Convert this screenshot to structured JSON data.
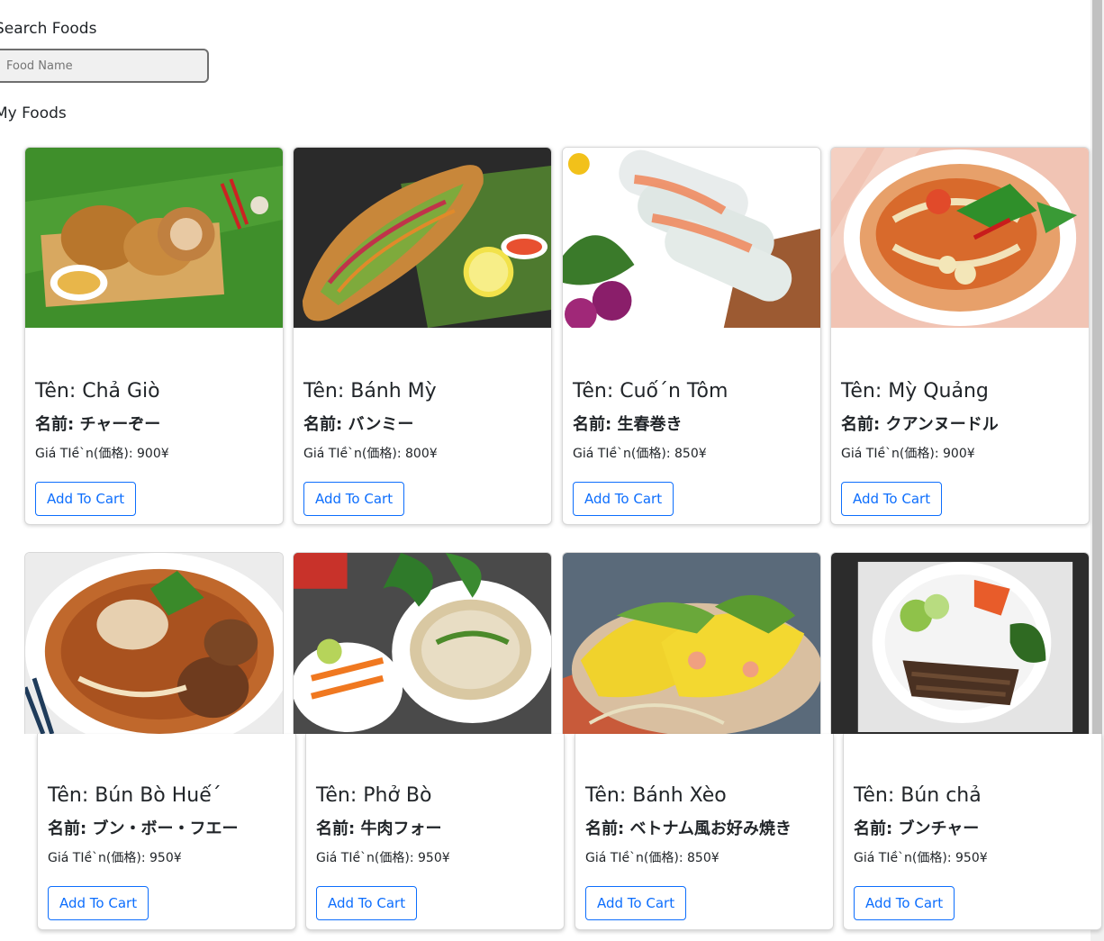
{
  "search": {
    "label": "Search Foods",
    "placeholder": "Food Name",
    "value": ""
  },
  "section": {
    "title": "My Foods"
  },
  "foods": [
    {
      "vn": "Tên: Chả Giò",
      "jp": "名前: チャーぞー",
      "price": "Giá TIề`n(価格): 900¥",
      "button": "Add To Cart"
    },
    {
      "vn": "Tên: Bánh Mỳ",
      "jp": "名前: バンミー",
      "price": "Giá TIề`n(価格): 800¥",
      "button": "Add To Cart"
    },
    {
      "vn": "Tên: Cuố´n Tôm",
      "jp": "名前: 生春巻き",
      "price": "Giá TIề`n(価格): 850¥",
      "button": "Add To Cart"
    },
    {
      "vn": "Tên: Mỳ Quảng",
      "jp": "名前: クアンヌードル",
      "price": "Giá TIề`n(価格): 900¥",
      "button": "Add To Cart"
    },
    {
      "vn": "Tên: Bún Bò Huế´",
      "jp": "名前: ブン・ボー・フエー",
      "price": "Giá TIề`n(価格): 950¥",
      "button": "Add To Cart"
    },
    {
      "vn": "Tên: Phở Bò",
      "jp": "名前: 牛肉フォー",
      "price": "Giá TIề`n(価格): 950¥",
      "button": "Add To Cart"
    },
    {
      "vn": "Tên: Bánh Xèo",
      "jp": "名前: ベトナム風お好み焼き",
      "price": "Giá TIề`n(価格): 850¥",
      "button": "Add To Cart"
    },
    {
      "vn": "Tên: Bún chả",
      "jp": "名前: ブンチャー",
      "price": "Giá TIề`n(価格): 950¥",
      "button": "Add To Cart"
    }
  ],
  "colors": {
    "primary": "#0d6efd",
    "card_border": "#d8d8d8",
    "input_bg": "#f0f0f0"
  }
}
